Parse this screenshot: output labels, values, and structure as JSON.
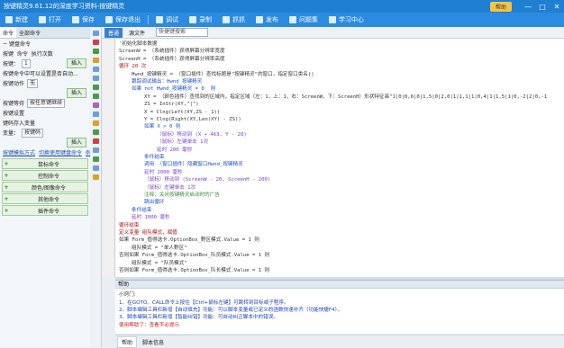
{
  "window": {
    "title": "按键精灵9.61.12的深度学习资料-按键精灵",
    "help_label": "帮助",
    "min_label": "—",
    "max_label": "□",
    "close_label": "✕"
  },
  "toolbar": {
    "buttons": [
      {
        "label": "新建",
        "icon": "new-icon"
      },
      {
        "label": "打开",
        "icon": "open-icon"
      },
      {
        "label": "保存",
        "icon": "save-icon"
      },
      {
        "label": "保存退出",
        "icon": "save-exit-icon"
      },
      {
        "label": "调试",
        "icon": "debug-icon"
      },
      {
        "label": "录制",
        "icon": "record-icon"
      },
      {
        "label": "抓抓",
        "icon": "grab-icon"
      },
      {
        "label": "发布",
        "icon": "publish-icon"
      },
      {
        "label": "问题集",
        "icon": "faq-icon"
      },
      {
        "label": "学习中心",
        "icon": "learn-icon"
      }
    ],
    "colors": {
      "bar": "#2a8be0",
      "title": "#1f7fd1"
    }
  },
  "left": {
    "tabs": [
      "命令",
      "全部命令"
    ],
    "rows": {
      "r1": "键盘命令",
      "r2_col1": "按键",
      "r2_col2": "命令",
      "r2_col3": "执行次数",
      "r3_label": "按键：",
      "r3_val": "1",
      "r3_btn": "插入",
      "r4": "按键命令中可以设置是否自动...",
      "r5_label": "按键动作",
      "r5_val": "无",
      "r6": "插入",
      "r7_label": "按键等待",
      "r7_val": "按任意键继续",
      "r8": "按键设置",
      "r9": "键码存入变量",
      "r10": "变量：",
      "r11_val": "按键码",
      "r12_btn": "插入",
      "link1": "按键模拟方式",
      "link2": "切换使用键盘命令",
      "link3": "例子"
    },
    "groups": [
      "鼠标命令",
      "控制命令",
      "颜色/图像命令",
      "其他命令",
      "插件命令"
    ]
  },
  "editor": {
    "tabs": [
      "普通",
      "源文件"
    ],
    "search_placeholder": "快捷键搜索",
    "lines": [
      {
        "text": "'初始化脚本数据",
        "color": "#333333",
        "indent": 0
      },
      {
        "text": "ScreenW = （系统插件）获得屏幕分辨率宽度",
        "color": "#333333",
        "indent": 0
      },
      {
        "text": "ScreenH = （系统插件）获得屏幕分辨率高度",
        "color": "#333333",
        "indent": 0
      },
      {
        "text": "循环 20 次",
        "color": "#b01010",
        "indent": 0
      },
      {
        "text": "Hwnd_按键精灵 = （窗口插件）查找标题是\"按键精灵\"的窗口，指定窗口类名()",
        "color": "#333333",
        "indent": 1
      },
      {
        "text": "跟踪调试输出：Hwnd_按键精灵",
        "color": "#1a4fc8",
        "indent": 1
      },
      {
        "text": "如果 not Hwnd_按键精灵 = 0  则",
        "color": "#1a4fc8",
        "indent": 1
      },
      {
        "text": "XY = （颜色插件）查找到的区域内，指定区域（左：1，上：1，右：ScreenW，下：ScreenH）形状特征串\"1|0|0,6|0|1,5|0|2,0|1|1,1|1|0,4|1|1,5|1|0,-2|2|0,-1",
        "color": "#333333",
        "indent": 2
      },
      {
        "text": "ZS = InStr(XY,\"|\")",
        "color": "#333333",
        "indent": 2
      },
      {
        "text": "X = Clng(Left(XY,ZS - 1))",
        "color": "#333333",
        "indent": 2
      },
      {
        "text": "Y = Clng(Right(XY,Len(XY) - ZS))",
        "color": "#333333",
        "indent": 2
      },
      {
        "text": "如果 X > 0 则",
        "color": "#1a4fc8",
        "indent": 2
      },
      {
        "text": "（鼠标）移动到 (X + 463, Y - 28)",
        "color": "#7a3fc8",
        "indent": 3
      },
      {
        "text": "（鼠标）左键单击 1次",
        "color": "#7a3fc8",
        "indent": 3
      },
      {
        "text": "延时 200 毫秒",
        "color": "#7a3fc8",
        "indent": 3
      },
      {
        "text": "条件结束",
        "color": "#1a4fc8",
        "indent": 2
      },
      {
        "text": "调用 （窗口插件）隐藏窗口Hwnd_按键精灵",
        "color": "#1a4fc8",
        "indent": 2
      },
      {
        "text": "延时 2000 毫秒",
        "color": "#7a3fc8",
        "indent": 2
      },
      {
        "text": "（鼠标）移动到 (ScreenW - 20, ScreenH - 200)",
        "color": "#7a3fc8",
        "indent": 2
      },
      {
        "text": "（鼠标）左键单击 1次",
        "color": "#7a3fc8",
        "indent": 2
      },
      {
        "text": "注释：关闭按键精灵启动时的广告",
        "color": "#3a8a3a",
        "indent": 2
      },
      {
        "text": "跳出循环",
        "color": "#1a4fc8",
        "indent": 2
      },
      {
        "text": "条件结束",
        "color": "#1a4fc8",
        "indent": 1
      },
      {
        "text": "延时 1000 毫秒",
        "color": "#7a3fc8",
        "indent": 1
      },
      {
        "text": "循环结束",
        "color": "#b01010",
        "indent": 0
      },
      {
        "text": "定义变量 组队模式，赋值",
        "color": "#b01010",
        "indent": 0
      },
      {
        "text": "如果 Form_值得选卡.OptionBox_野区模式.Value = 1 则",
        "color": "#333333",
        "indent": 0
      },
      {
        "text": "组队模式 = \"单人野区\"",
        "color": "#333333",
        "indent": 1
      },
      {
        "text": "否则如果 Form_值得选卡.OptionBox_队员模式.Value = 1 则",
        "color": "#333333",
        "indent": 0
      },
      {
        "text": "组队模式 = \"队员模式\"",
        "color": "#333333",
        "indent": 1
      },
      {
        "text": "否则如果 Form_值得选卡.OptionBox_队长模式.Value = 1 则",
        "color": "#333333",
        "indent": 0
      }
    ]
  },
  "helppanel": {
    "title": "帮助",
    "lines": [
      "小窍门:",
      "1、在GOTO、CALL命令上按住【Ctrl+鼠标左键】可跳转到目标或子程序。",
      "2、脚本编辑工具栏新增【自动填充】功能：可以脚本变量或已定义的函数快速补齐（功能快捷F4）。",
      "3、脚本编辑工具栏新增【智能纠错】功能：可自动纠正脚本中的错误。",
      "使用帮助了：查看不必提示"
    ],
    "bottom_tabs": [
      "帮助",
      "脚本信息"
    ]
  }
}
